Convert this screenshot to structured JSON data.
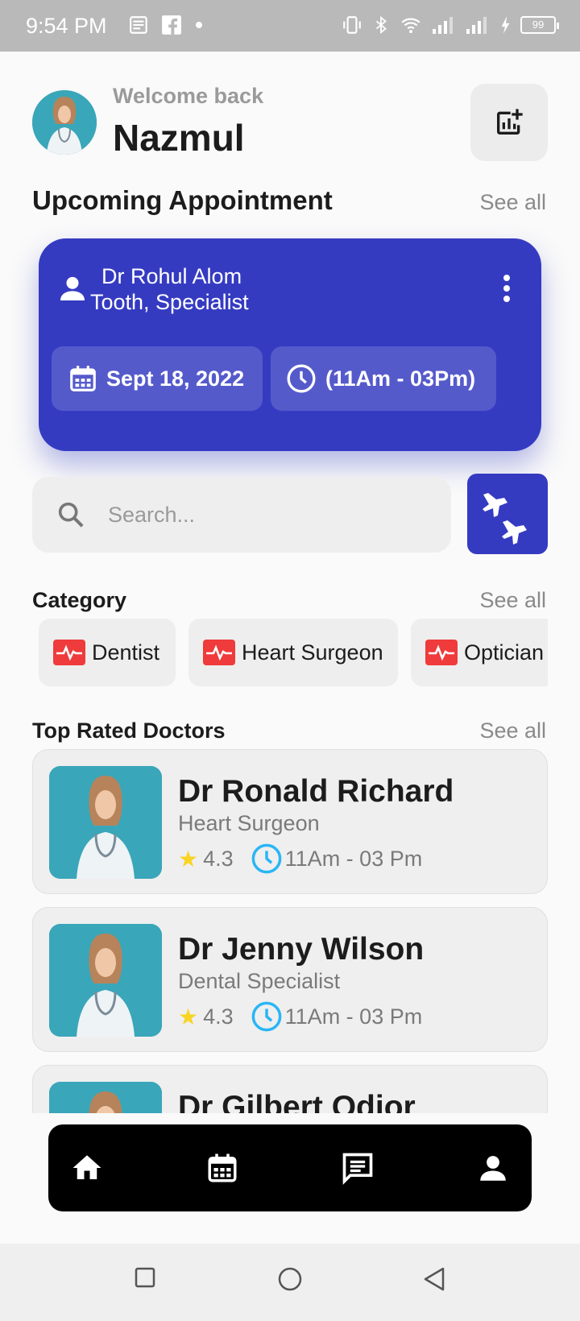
{
  "status_bar": {
    "time": "9:54 PM",
    "battery": "99"
  },
  "header": {
    "welcome": "Welcome back",
    "name": "Nazmul"
  },
  "upcoming": {
    "title": "Upcoming Appointment",
    "see_all": "See all",
    "doctor": "Dr Rohul Alom",
    "specialty": "Tooth, Specialist",
    "date": "Sept 18, 2022",
    "time": "(11Am - 03Pm)"
  },
  "search": {
    "placeholder": "Search..."
  },
  "category": {
    "title": "Category",
    "see_all": "See all",
    "items": [
      {
        "label": "Dentist"
      },
      {
        "label": "Heart Surgeon"
      },
      {
        "label": "Optician"
      }
    ]
  },
  "top_rated": {
    "title": "Top Rated Doctors",
    "see_all": "See all",
    "doctors": [
      {
        "name": "Dr Ronald Richard",
        "specialty": "Heart Surgeon",
        "rating": "4.3",
        "hours": "11Am - 03 Pm"
      },
      {
        "name": "Dr Jenny Wilson",
        "specialty": "Dental Specialist",
        "rating": "4.3",
        "hours": "11Am - 03 Pm"
      },
      {
        "name": "Dr Gilbert Odior",
        "specialty": "",
        "rating": "",
        "hours": ""
      }
    ]
  },
  "bottom_nav": {
    "items": [
      {
        "icon": "home-icon"
      },
      {
        "icon": "calendar-icon"
      },
      {
        "icon": "chat-icon"
      },
      {
        "icon": "person-icon"
      }
    ]
  },
  "colors": {
    "primary": "#353bc1",
    "category_icon": "#ef3b3b",
    "clock_accent": "#29b6f6",
    "star": "#f9d423"
  }
}
